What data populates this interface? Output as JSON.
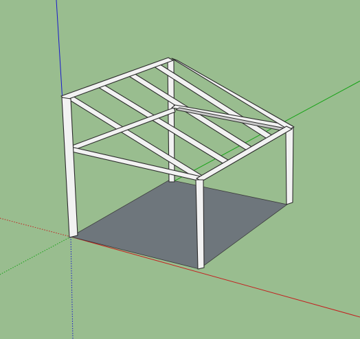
{
  "app": {
    "view": "3d-model-viewport"
  },
  "model": {
    "object": "open-frame-shed",
    "components": [
      "floor-slab",
      "front-left-post",
      "front-right-post",
      "back-left-post",
      "back-right-post",
      "top-beams",
      "roof-rafters",
      "ridge-beam"
    ]
  },
  "colors": {
    "background": "#99bd8f",
    "floor": "#6c757b",
    "beam_fill": "#f2f2f2",
    "beam_edge": "#2b2b2b",
    "axis_red": "#cc0000",
    "axis_green": "#00aa00",
    "axis_blue": "#0000cc"
  }
}
